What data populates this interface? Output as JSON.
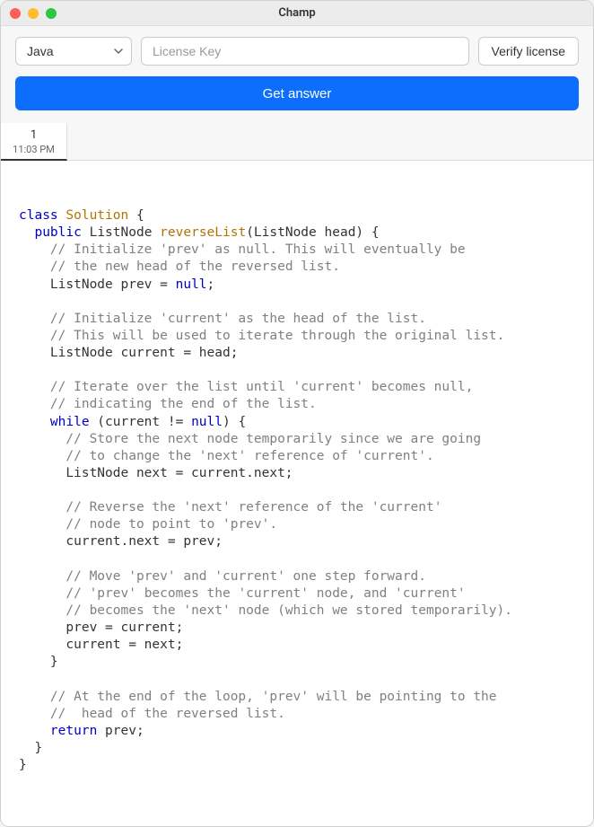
{
  "window": {
    "title": "Champ"
  },
  "toolbar": {
    "language_selected": "Java",
    "license_placeholder": "License Key",
    "verify_label": "Verify license"
  },
  "actions": {
    "get_answer_label": "Get answer"
  },
  "tabs": [
    {
      "num": "1",
      "time": "11:03 PM"
    }
  ],
  "code": {
    "tokens": [
      {
        "t": "kw",
        "v": "class"
      },
      {
        "v": " "
      },
      {
        "t": "type",
        "v": "Solution"
      },
      {
        "v": " {\n"
      },
      {
        "v": "  "
      },
      {
        "t": "kw",
        "v": "public"
      },
      {
        "v": " ListNode "
      },
      {
        "t": "fn",
        "v": "reverseList"
      },
      {
        "v": "(ListNode head) {\n"
      },
      {
        "v": "    "
      },
      {
        "t": "cmt",
        "v": "// Initialize 'prev' as null. This will eventually be"
      },
      {
        "v": "\n"
      },
      {
        "v": "    "
      },
      {
        "t": "cmt",
        "v": "// the new head of the reversed list."
      },
      {
        "v": "\n"
      },
      {
        "v": "    ListNode prev = "
      },
      {
        "t": "lit",
        "v": "null"
      },
      {
        "v": ";\n"
      },
      {
        "v": "\n"
      },
      {
        "v": "    "
      },
      {
        "t": "cmt",
        "v": "// Initialize 'current' as the head of the list."
      },
      {
        "v": "\n"
      },
      {
        "v": "    "
      },
      {
        "t": "cmt",
        "v": "// This will be used to iterate through the original list."
      },
      {
        "v": "\n"
      },
      {
        "v": "    ListNode current = head;\n"
      },
      {
        "v": "\n"
      },
      {
        "v": "    "
      },
      {
        "t": "cmt",
        "v": "// Iterate over the list until 'current' becomes null,"
      },
      {
        "v": "\n"
      },
      {
        "v": "    "
      },
      {
        "t": "cmt",
        "v": "// indicating the end of the list."
      },
      {
        "v": "\n"
      },
      {
        "v": "    "
      },
      {
        "t": "kw",
        "v": "while"
      },
      {
        "v": " (current != "
      },
      {
        "t": "lit",
        "v": "null"
      },
      {
        "v": ") {\n"
      },
      {
        "v": "      "
      },
      {
        "t": "cmt",
        "v": "// Store the next node temporarily since we are going"
      },
      {
        "v": "\n"
      },
      {
        "v": "      "
      },
      {
        "t": "cmt",
        "v": "// to change the 'next' reference of 'current'."
      },
      {
        "v": "\n"
      },
      {
        "v": "      ListNode next = current.next;\n"
      },
      {
        "v": "\n"
      },
      {
        "v": "      "
      },
      {
        "t": "cmt",
        "v": "// Reverse the 'next' reference of the 'current'"
      },
      {
        "v": "\n"
      },
      {
        "v": "      "
      },
      {
        "t": "cmt",
        "v": "// node to point to 'prev'."
      },
      {
        "v": "\n"
      },
      {
        "v": "      current.next = prev;\n"
      },
      {
        "v": "\n"
      },
      {
        "v": "      "
      },
      {
        "t": "cmt",
        "v": "// Move 'prev' and 'current' one step forward."
      },
      {
        "v": "\n"
      },
      {
        "v": "      "
      },
      {
        "t": "cmt",
        "v": "// 'prev' becomes the 'current' node, and 'current'"
      },
      {
        "v": "\n"
      },
      {
        "v": "      "
      },
      {
        "t": "cmt",
        "v": "// becomes the 'next' node (which we stored temporarily)."
      },
      {
        "v": "\n"
      },
      {
        "v": "      prev = current;\n"
      },
      {
        "v": "      current = next;\n"
      },
      {
        "v": "    }\n"
      },
      {
        "v": "\n"
      },
      {
        "v": "    "
      },
      {
        "t": "cmt",
        "v": "// At the end of the loop, 'prev' will be pointing to the"
      },
      {
        "v": "\n"
      },
      {
        "v": "    "
      },
      {
        "t": "cmt",
        "v": "//  head of the reversed list."
      },
      {
        "v": "\n"
      },
      {
        "v": "    "
      },
      {
        "t": "kw",
        "v": "return"
      },
      {
        "v": " prev;\n"
      },
      {
        "v": "  }\n"
      },
      {
        "v": "}\n"
      }
    ]
  }
}
